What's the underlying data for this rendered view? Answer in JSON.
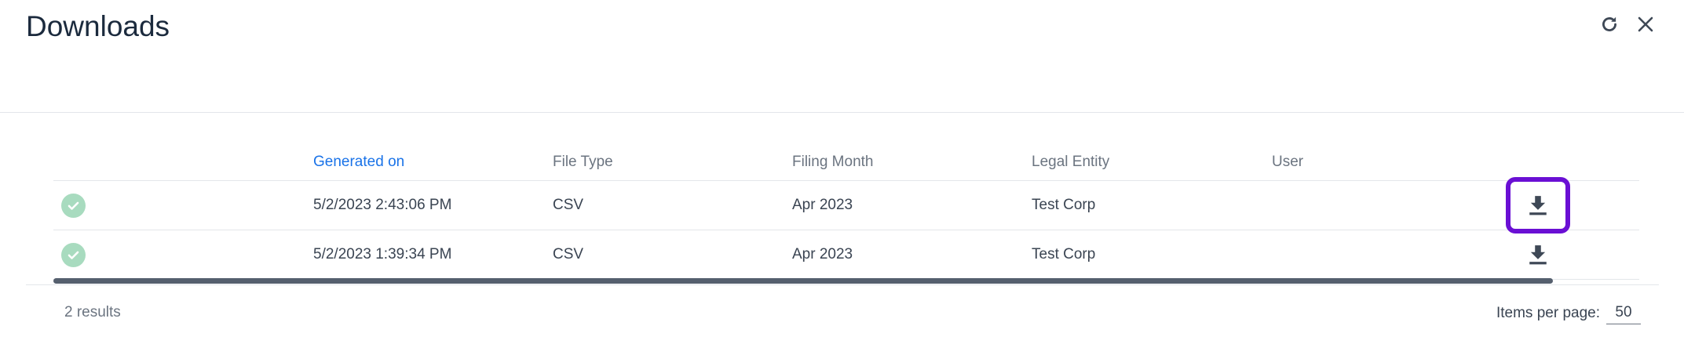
{
  "header": {
    "title": "Downloads",
    "refresh_icon": "refresh-icon",
    "close_icon": "close-icon"
  },
  "table": {
    "columns": [
      "",
      "Generated on",
      "File Type",
      "Filing Month",
      "Legal Entity",
      "User",
      ""
    ],
    "sorted_column": "Generated on",
    "rows": [
      {
        "status": "completed",
        "generated_on": "5/2/2023 2:43:06 PM",
        "file_type": "CSV",
        "filing_month": "Apr 2023",
        "legal_entity": "Test Corp",
        "user": "",
        "action_icon": "download-icon"
      },
      {
        "status": "completed",
        "generated_on": "5/2/2023 1:39:34 PM",
        "file_type": "CSV",
        "filing_month": "Apr 2023",
        "legal_entity": "Test Corp",
        "user": "",
        "action_icon": "download-icon"
      }
    ]
  },
  "footer": {
    "results": "2 results",
    "items_per_page_label": "Items per page:",
    "items_per_page_value": "50"
  },
  "colors": {
    "title": "#1b2a3d",
    "sorted_header": "#1a73e8",
    "status_ok": "#a8dbbf",
    "focus_ring": "#6a0fd4",
    "scrollbar": "#555f6e"
  }
}
